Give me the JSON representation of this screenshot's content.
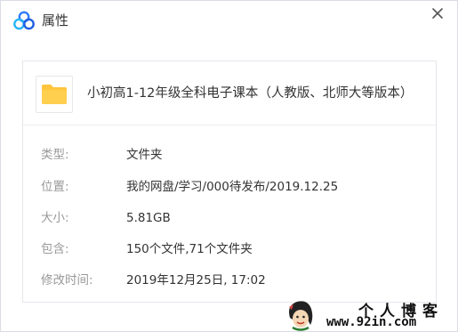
{
  "window": {
    "title": "属性",
    "app_icon": "baidu-netdisk-cloud-icon",
    "close_icon": "close-icon"
  },
  "file": {
    "icon": "folder-icon",
    "name": "小初高1-12年级全科电子课本（人教版、北师大等版本）"
  },
  "properties": [
    {
      "label": "类型:",
      "value": "文件夹"
    },
    {
      "label": "位置:",
      "value": "我的网盘/学习/000待发布/2019.12.25"
    },
    {
      "label": "大小:",
      "value": "5.81GB"
    },
    {
      "label": "包含:",
      "value": "150个文件,71个文件夹"
    },
    {
      "label": "修改时间:",
      "value": "2019年12月25日, 17:02"
    }
  ],
  "watermark": {
    "title": "个人博客",
    "url": "www.92in.com"
  },
  "colors": {
    "folder": "#ffc53d",
    "label": "#999999",
    "value": "#333333",
    "border": "#e4e7ec"
  }
}
